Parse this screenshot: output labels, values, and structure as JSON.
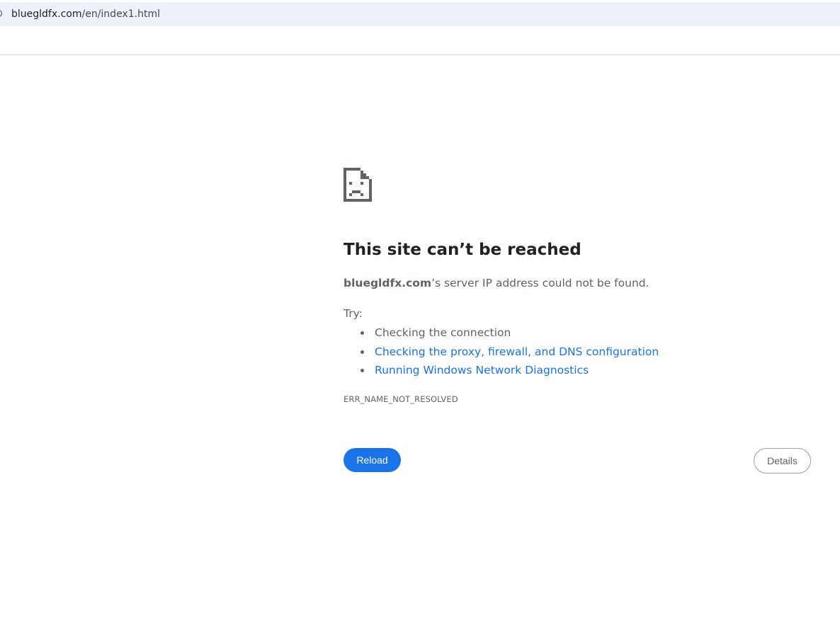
{
  "browser": {
    "url_host": "bluegldfx.com",
    "url_path": "/en/index1.html"
  },
  "error_page": {
    "icon": "sad-page-icon",
    "title": "This site can’t be reached",
    "desc_host": "bluegldfx.com",
    "desc_rest": "’s server IP address could not be found.",
    "try_label": "Try:",
    "suggestions": [
      {
        "label": "Checking the connection",
        "link": false
      },
      {
        "label": "Checking the proxy, firewall, and DNS configuration",
        "link": true
      },
      {
        "label": "Running Windows Network Diagnostics",
        "link": true
      }
    ],
    "error_code": "ERR_NAME_NOT_RESOLVED",
    "reload_label": "Reload",
    "details_label": "Details"
  },
  "colors": {
    "accent": "#1a73e8",
    "text_secondary": "#5f6368",
    "omnibox_bg": "#edf2fa"
  }
}
